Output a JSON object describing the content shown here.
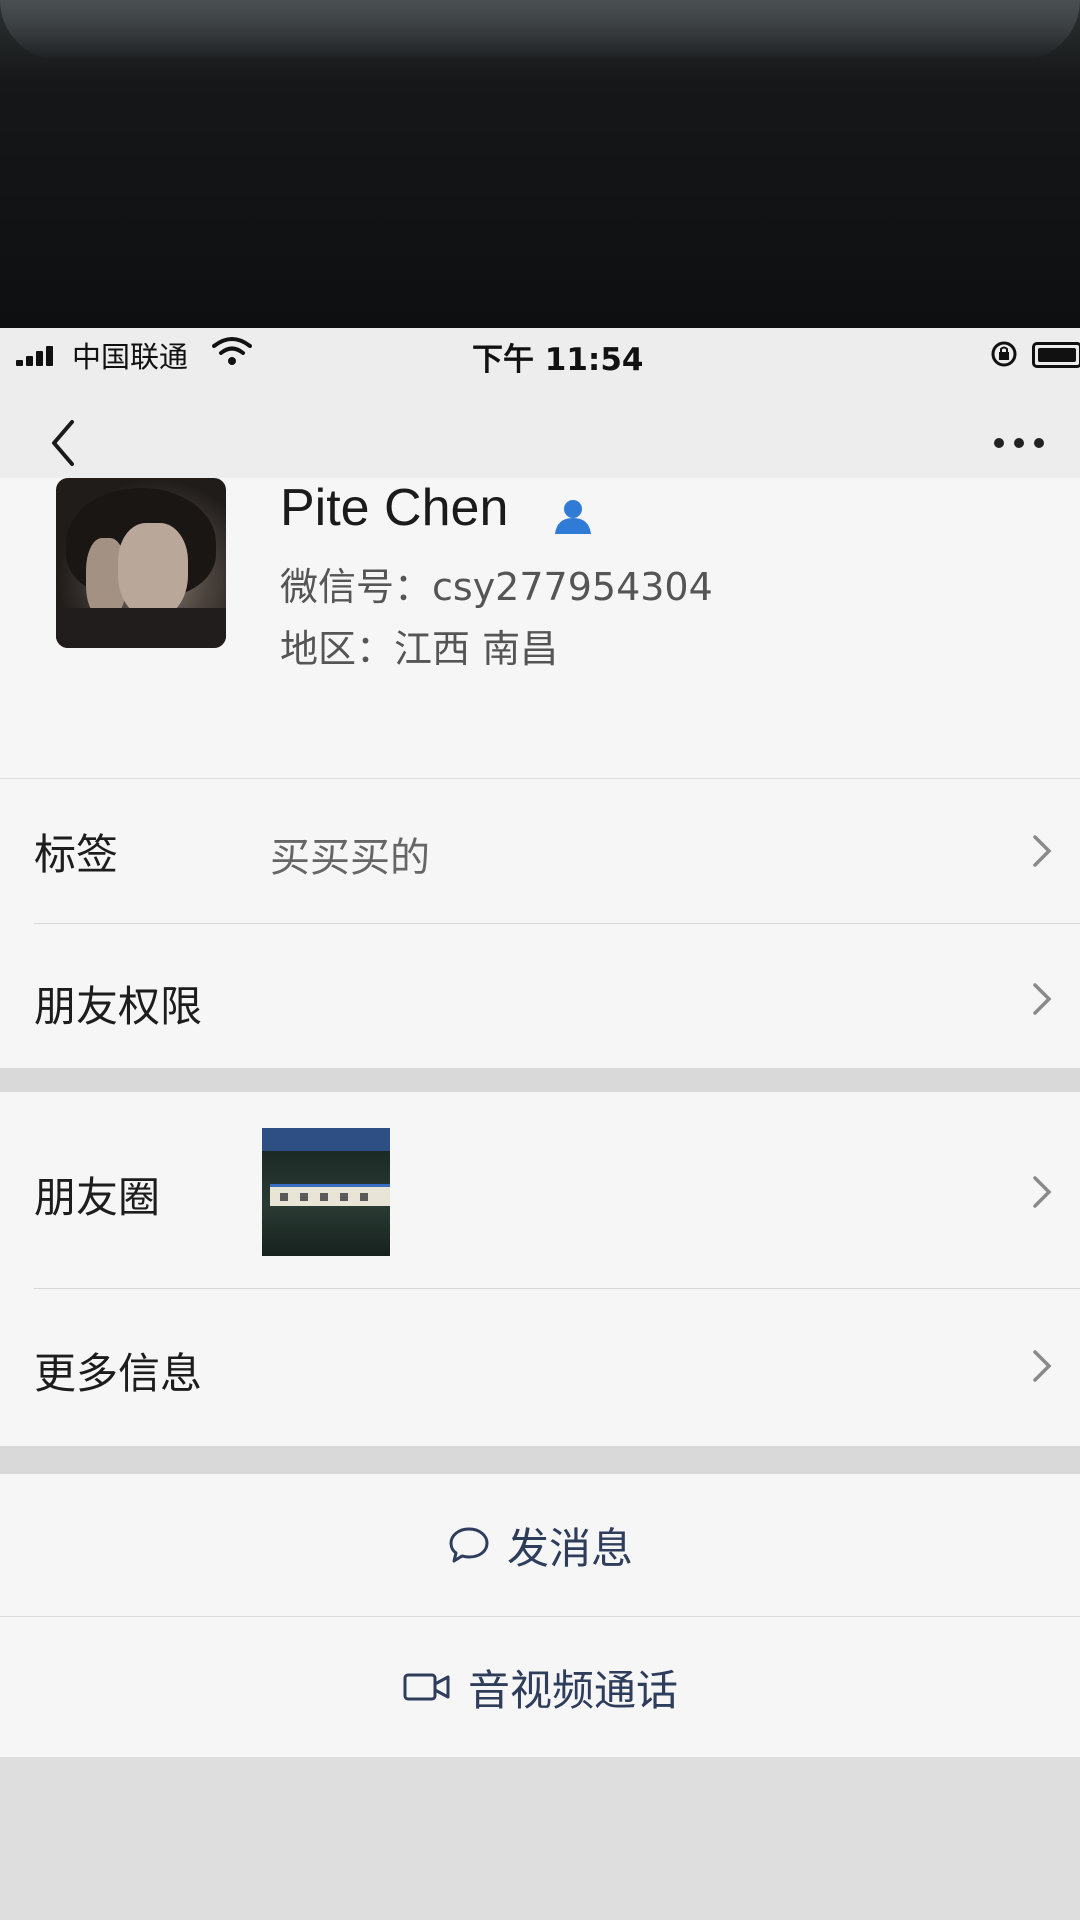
{
  "status_bar": {
    "carrier": "中国联通",
    "time": "下午 11:54"
  },
  "nav": {
    "back_icon": "chevron-left-icon",
    "more_icon": "more-icon"
  },
  "profile": {
    "name": "Pite Chen",
    "wechat_id": "微信号：csy277954304",
    "region": "地区：江西 南昌"
  },
  "rows": {
    "tags_label": "标签",
    "tags_value": "买买买的",
    "permissions_label": "朋友权限",
    "moments_label": "朋友圈",
    "more_info_label": "更多信息"
  },
  "actions": {
    "message_label": "发消息",
    "call_label": "音视频通话"
  },
  "colors": {
    "accent": "#2f7bd6",
    "action_text": "#2e3d5c",
    "background": "#ededed",
    "row_background": "#f6f6f6"
  }
}
